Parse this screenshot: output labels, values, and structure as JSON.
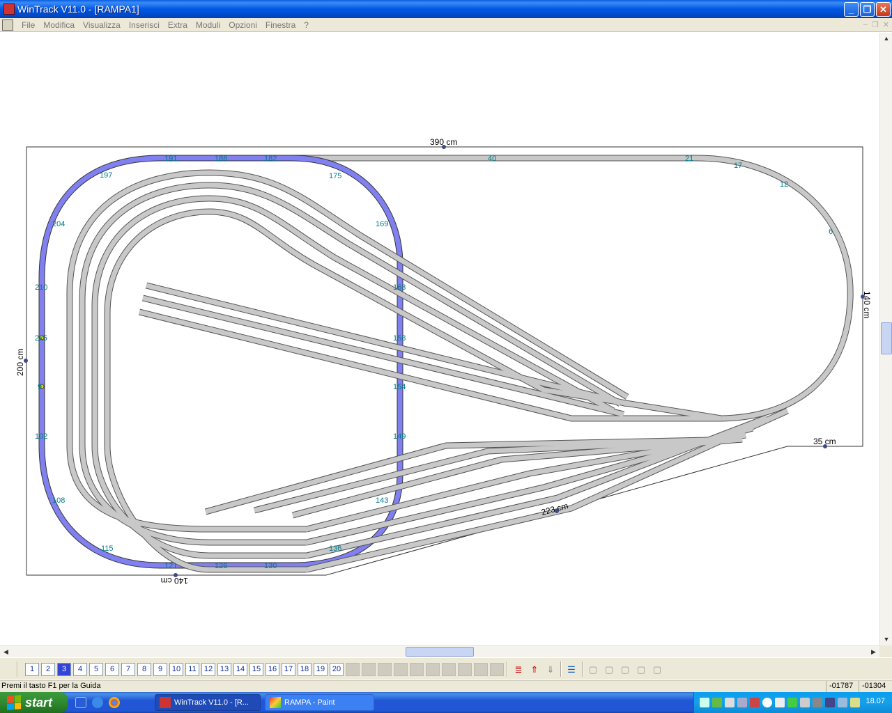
{
  "window": {
    "title": "WinTrack  V11.0 - [RAMPA1]",
    "minimize": "_",
    "restore": "❐",
    "close": "✕"
  },
  "menu": {
    "items": [
      "File",
      "Modifica",
      "Visualizza",
      "Inserisci",
      "Extra",
      "Moduli",
      "Opzioni",
      "Finestra",
      "?"
    ]
  },
  "drawing": {
    "dimension_top": "390 cm",
    "dimension_right": "140 cm",
    "dimension_left": "200 cm",
    "dimension_bottom": "140 cm",
    "dimension_diagonal": "223 cm",
    "dimension_small": "35 cm",
    "helix_numbers": [
      "191",
      "186",
      "182",
      "197",
      "175",
      "204",
      "169",
      "210",
      "163",
      "158",
      "154",
      "102",
      "149",
      "108",
      "143",
      "115",
      "136",
      "121",
      "126",
      "130"
    ],
    "top_track_numbers": [
      "40",
      "21",
      "17",
      "12",
      "6"
    ],
    "small_labels": [
      "2x5",
      "9"
    ],
    "track_color": "#c8c8c8",
    "helix_color": "#8080f0",
    "label_color": "#007b8a"
  },
  "layers": {
    "numbers": [
      "1",
      "2",
      "3",
      "4",
      "5",
      "6",
      "7",
      "8",
      "9",
      "10",
      "11",
      "12",
      "13",
      "14",
      "15",
      "16",
      "17",
      "18",
      "19",
      "20"
    ],
    "active": "3"
  },
  "status": {
    "message": "Premi il tasto F1 per la Guida",
    "coord_x": "-01787",
    "coord_y": "-01304"
  },
  "taskbar": {
    "start": "start",
    "tasks": [
      "WinTrack  V11.0 - [R...",
      "RAMPA - Paint"
    ],
    "clock": "18.07"
  }
}
